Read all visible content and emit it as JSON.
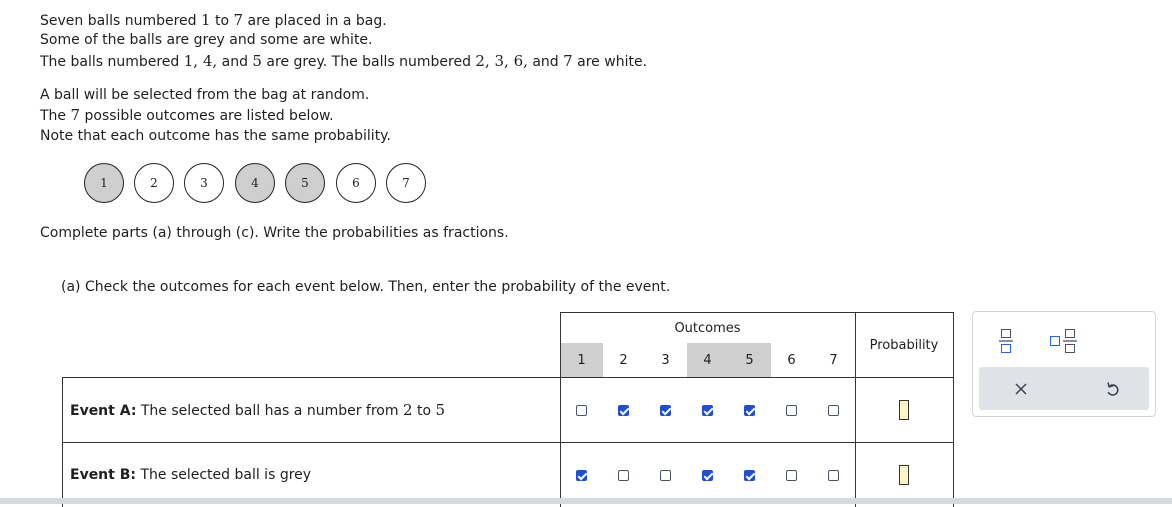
{
  "intro": {
    "l1": [
      "Seven balls numbered ",
      "1",
      " to ",
      "7",
      " are placed in a bag."
    ],
    "l2": [
      "Some of the balls are grey and some are white."
    ],
    "l3": [
      "The balls numbered ",
      "1, 4,",
      " and ",
      "5",
      " are grey. The balls numbered ",
      "2, 3, 6,",
      " and ",
      "7",
      " are white."
    ],
    "l4": [
      "A ball will be selected from the bag at random."
    ],
    "l5": [
      "The ",
      "7",
      " possible outcomes are listed below."
    ],
    "l6": [
      "Note that each outcome has the same probability."
    ],
    "l7": [
      "Complete parts (a) through (c). Write the probabilities as fractions."
    ]
  },
  "balls": [
    {
      "label": "1",
      "color": "grey"
    },
    {
      "label": "2",
      "color": "white"
    },
    {
      "label": "3",
      "color": "white"
    },
    {
      "label": "4",
      "color": "grey"
    },
    {
      "label": "5",
      "color": "grey"
    },
    {
      "label": "6",
      "color": "white"
    },
    {
      "label": "7",
      "color": "white"
    }
  ],
  "part_a": {
    "instruction": "(a) Check the outcomes for each event below. Then, enter the probability of the event.",
    "outcomes_header": "Outcomes",
    "probability_header": "Probability",
    "outcome_numbers": [
      "1",
      "2",
      "3",
      "4",
      "5",
      "6",
      "7"
    ],
    "events": [
      {
        "name": "Event A:",
        "desc_prefix": " The selected ball has a number from ",
        "from": "2",
        "mid": " to ",
        "to": "5",
        "checks": [
          false,
          true,
          true,
          true,
          true,
          false,
          false
        ],
        "probability": ""
      },
      {
        "name": "Event B:",
        "desc_prefix": " The selected ball is grey",
        "from": "",
        "mid": "",
        "to": "",
        "checks": [
          true,
          false,
          false,
          true,
          true,
          false,
          false
        ],
        "probability": ""
      }
    ]
  },
  "colors": {
    "grey_ball": "#cfcfcf",
    "check_blue": "#1d4ed8",
    "answer_box": "#fff6c8"
  },
  "palette": {
    "tools": [
      "fraction-icon",
      "mixed-number-icon"
    ],
    "actions": [
      "clear-icon",
      "undo-icon"
    ]
  }
}
